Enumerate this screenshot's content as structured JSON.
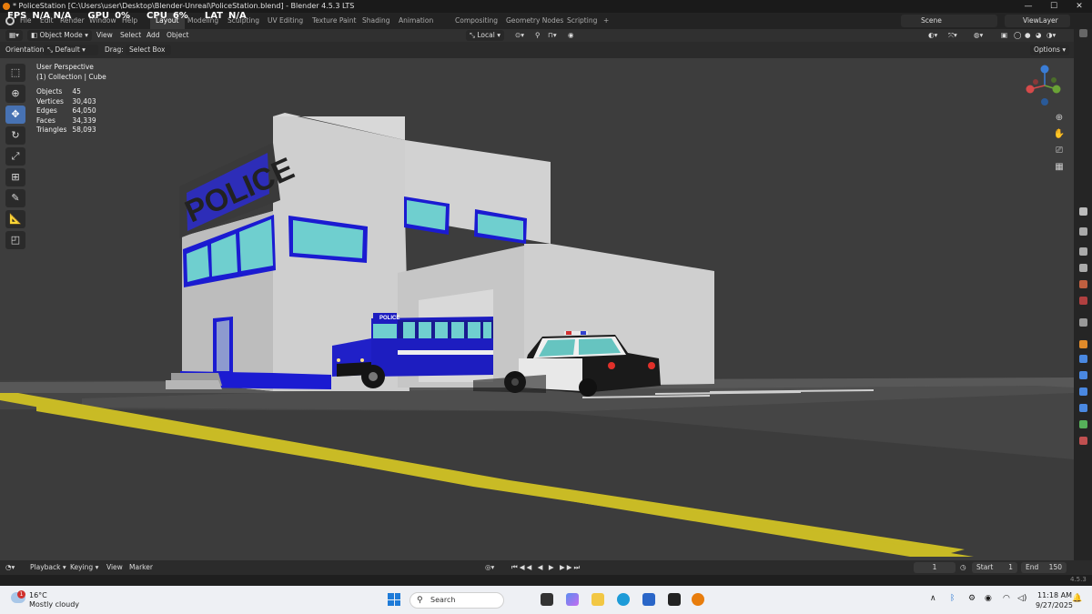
{
  "window": {
    "title": "* PoliceStation [C:\\Users\\user\\Desktop\\Blender-Unreal\\PoliceStation.blend] - Blender 4.5.3 LTS",
    "minimize": "—",
    "maximize": "☐",
    "close": "✕"
  },
  "perf": {
    "fps_label": "FPS",
    "fps_value": "N/A N/A",
    "gpu_label": "GPU",
    "gpu_value": "0%",
    "cpu_label": "CPU",
    "cpu_value": "6%",
    "lat_label": "LAT",
    "lat_value": "N/A"
  },
  "menu": [
    "File",
    "Edit",
    "Render",
    "Window",
    "Help"
  ],
  "workspaces": [
    "Layout",
    "Modeling",
    "Sculpting",
    "UV Editing",
    "Texture Paint",
    "Shading",
    "Animation",
    "Compositing",
    "Geometry Nodes",
    "Scripting"
  ],
  "workspace_add": "+",
  "scene_name": "Scene",
  "view_layer": "ViewLayer",
  "header": {
    "mode": "Object Mode",
    "items": [
      "View",
      "Select",
      "Add",
      "Object"
    ],
    "transform_space": "Local"
  },
  "toolsettings": {
    "orientation_label": "Orientation:",
    "orientation_value": "Default",
    "drag_label": "Drag:",
    "drag_value": "Select Box",
    "options": "Options"
  },
  "viewport": {
    "view_name": "User Perspective",
    "collection": "(1) Collection | Cube",
    "stats": [
      {
        "label": "Objects",
        "value": "45"
      },
      {
        "label": "Vertices",
        "value": "30,403"
      },
      {
        "label": "Edges",
        "value": "64,050"
      },
      {
        "label": "Faces",
        "value": "34,339"
      },
      {
        "label": "Triangles",
        "value": "58,093"
      }
    ],
    "sign_text": "POLICE",
    "bus_sign": "POLICE"
  },
  "timeline": {
    "menus": [
      "Playback",
      "Keying",
      "View",
      "Marker"
    ],
    "current_frame": "1",
    "start_label": "Start",
    "start_value": "1",
    "end_label": "End",
    "end_value": "150",
    "version": "4.5.3"
  },
  "taskbar": {
    "weather_temp": "16°C",
    "weather_desc": "Mostly cloudy",
    "weather_badge": "1",
    "search_placeholder": "Search",
    "time": "11:18 AM",
    "date": "9/27/2025"
  },
  "colors": {
    "accent": "#4772b3",
    "blender_orange": "#e87d0d",
    "police_blue": "#1a1ecf"
  }
}
